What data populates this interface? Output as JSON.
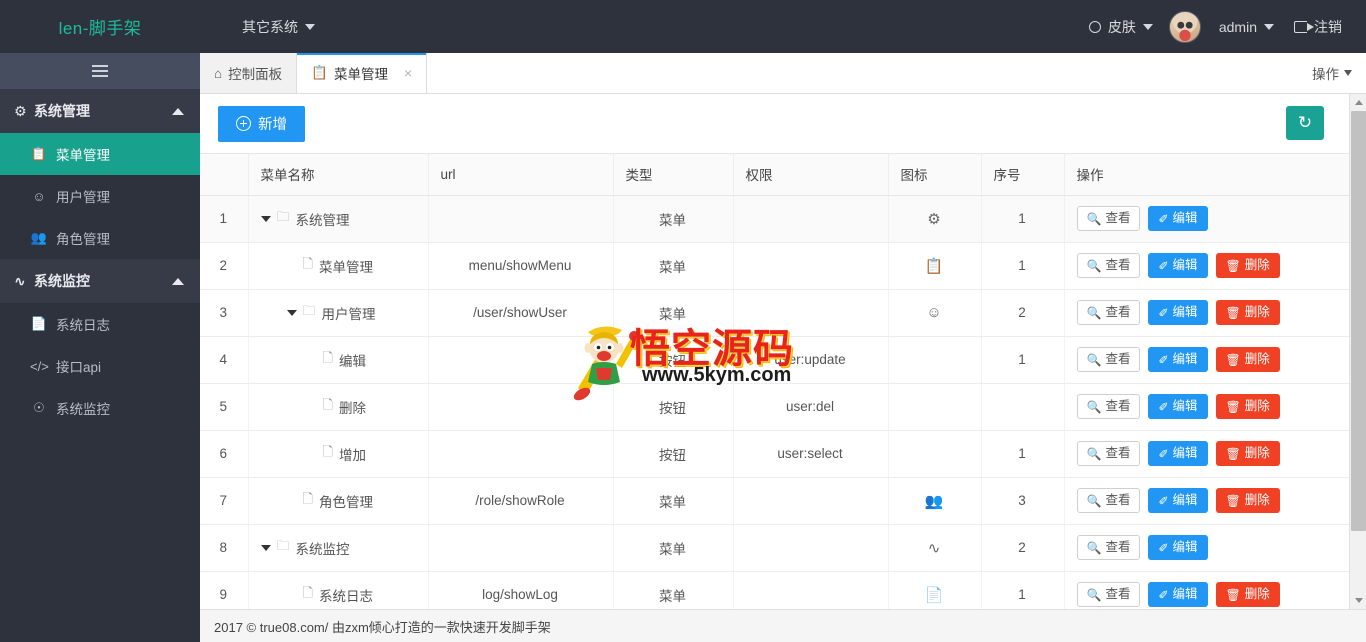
{
  "topbar": {
    "brand": "len-脚手架",
    "nav_left": [
      {
        "label": "其它系统",
        "icon": "chevron-down-icon"
      }
    ],
    "skin": {
      "label": "皮肤",
      "icon": "circle-icon"
    },
    "user": {
      "name": "admin",
      "avatar": "user-avatar"
    },
    "logout": {
      "label": "注销",
      "icon": "logout-icon"
    },
    "accent_color": "#1abc9c",
    "bg_color": "#2e323c"
  },
  "sidebar": {
    "hamburger": "hamburger-icon",
    "groups": [
      {
        "label": "系统管理",
        "icon": "gear-icon",
        "glyph": "⚙",
        "expanded": true,
        "items": [
          {
            "label": "菜单管理",
            "icon": "menu-list-icon",
            "glyph": "📋",
            "active": true
          },
          {
            "label": "用户管理",
            "icon": "smiley-face-icon",
            "glyph": "☺",
            "active": false
          },
          {
            "label": "角色管理",
            "icon": "users-icon",
            "glyph": "👥",
            "active": false
          }
        ]
      },
      {
        "label": "系统监控",
        "icon": "pulse-icon",
        "glyph": "∿",
        "expanded": true,
        "items": [
          {
            "label": "系统日志",
            "icon": "document-icon",
            "glyph": "📄",
            "active": false
          },
          {
            "label": "接口api",
            "icon": "code-icon",
            "glyph": "</>",
            "active": false
          },
          {
            "label": "系统监控",
            "icon": "monitor-icon",
            "glyph": "☉",
            "active": false
          }
        ]
      }
    ],
    "active_color": "#18a28e"
  },
  "tabs": {
    "items": [
      {
        "label": "控制面板",
        "icon": "home-icon",
        "glyph": "⌂",
        "active": false,
        "closable": false
      },
      {
        "label": "菜单管理",
        "icon": "menu-list-icon",
        "glyph": "📋",
        "active": true,
        "closable": true
      }
    ],
    "close_glyph": "×",
    "right_menu": {
      "label": "操作",
      "icon": "chevron-down-icon"
    }
  },
  "toolbar": {
    "add_label": "新增",
    "add_icon": "plus-circle-icon",
    "refresh_icon": "refresh-icon",
    "refresh_glyph": "↻",
    "add_color": "#2196f3",
    "refresh_color": "#1aa394"
  },
  "table": {
    "columns": [
      {
        "key": "idx",
        "label": ""
      },
      {
        "key": "name",
        "label": "菜单名称"
      },
      {
        "key": "url",
        "label": "url"
      },
      {
        "key": "type",
        "label": "类型"
      },
      {
        "key": "perm",
        "label": "权限"
      },
      {
        "key": "icon",
        "label": "图标"
      },
      {
        "key": "ord",
        "label": "序号"
      },
      {
        "key": "act",
        "label": "操作"
      }
    ],
    "action_labels": {
      "view": "查看",
      "edit": "编辑",
      "delete": "删除"
    },
    "action_icons": {
      "view": "magnifier-icon",
      "edit": "pencil-icon",
      "delete": "trash-icon"
    },
    "rows": [
      {
        "idx": "1",
        "name": "系统管理",
        "url": "",
        "type": "菜单",
        "perm": "",
        "icon_glyph": "⚙",
        "icon_name": "gear-icon",
        "ord": "1",
        "depth": 0,
        "expandable": true,
        "highlight": true,
        "actions": [
          "view",
          "edit"
        ]
      },
      {
        "idx": "2",
        "name": "菜单管理",
        "url": "menu/showMenu",
        "type": "菜单",
        "perm": "",
        "icon_glyph": "📋",
        "icon_name": "menu-list-icon",
        "ord": "1",
        "depth": 1,
        "expandable": false,
        "highlight": false,
        "actions": [
          "view",
          "edit",
          "delete"
        ]
      },
      {
        "idx": "3",
        "name": "用户管理",
        "url": "/user/showUser",
        "type": "菜单",
        "perm": "",
        "icon_glyph": "☺",
        "icon_name": "smiley-face-icon",
        "ord": "2",
        "depth": 1,
        "expandable": true,
        "highlight": false,
        "actions": [
          "view",
          "edit",
          "delete"
        ]
      },
      {
        "idx": "4",
        "name": "编辑",
        "url": "",
        "type": "按钮",
        "perm": "user:update",
        "icon_glyph": "",
        "icon_name": "",
        "ord": "1",
        "depth": 2,
        "expandable": false,
        "highlight": false,
        "actions": [
          "view",
          "edit",
          "delete"
        ]
      },
      {
        "idx": "5",
        "name": "删除",
        "url": "",
        "type": "按钮",
        "perm": "user:del",
        "icon_glyph": "",
        "icon_name": "",
        "ord": "",
        "depth": 2,
        "expandable": false,
        "highlight": false,
        "actions": [
          "view",
          "edit",
          "delete"
        ]
      },
      {
        "idx": "6",
        "name": "增加",
        "url": "",
        "type": "按钮",
        "perm": "user:select",
        "icon_glyph": "",
        "icon_name": "",
        "ord": "1",
        "depth": 2,
        "expandable": false,
        "highlight": false,
        "actions": [
          "view",
          "edit",
          "delete"
        ]
      },
      {
        "idx": "7",
        "name": "角色管理",
        "url": "/role/showRole",
        "type": "菜单",
        "perm": "",
        "icon_glyph": "👥",
        "icon_name": "users-icon",
        "ord": "3",
        "depth": 1,
        "expandable": false,
        "highlight": false,
        "actions": [
          "view",
          "edit",
          "delete"
        ]
      },
      {
        "idx": "8",
        "name": "系统监控",
        "url": "",
        "type": "菜单",
        "perm": "",
        "icon_glyph": "∿",
        "icon_name": "pulse-icon",
        "ord": "2",
        "depth": 0,
        "expandable": true,
        "highlight": false,
        "actions": [
          "view",
          "edit"
        ]
      },
      {
        "idx": "9",
        "name": "系统日志",
        "url": "log/showLog",
        "type": "菜单",
        "perm": "",
        "icon_glyph": "📄",
        "icon_name": "document-icon",
        "ord": "1",
        "depth": 1,
        "expandable": false,
        "highlight": false,
        "actions": [
          "view",
          "edit",
          "delete"
        ]
      }
    ]
  },
  "watermark": {
    "text": "悟空源码",
    "url": "www.5kym.com",
    "text_color": "#e8231c"
  },
  "footer": {
    "text": "2017 © true08.com/ 由zxm倾心打造的一款快速开发脚手架"
  },
  "scrollbar": {
    "up": "scroll-up-arrow",
    "down": "scroll-down-arrow"
  }
}
